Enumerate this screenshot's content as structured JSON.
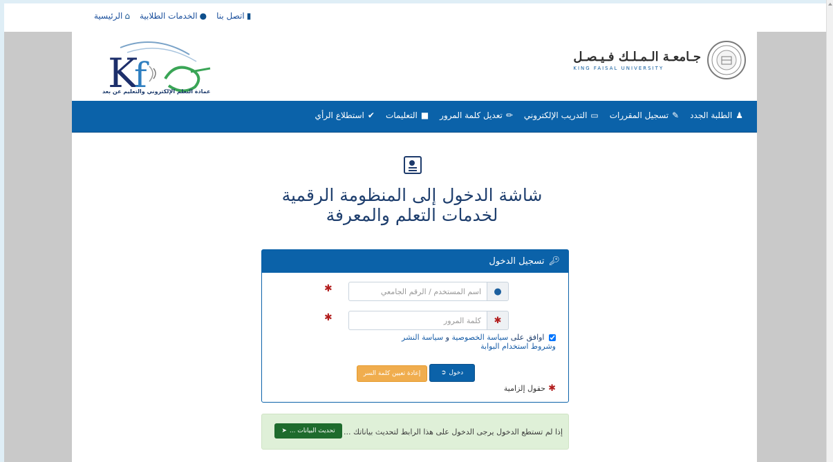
{
  "topbar": {
    "links": [
      {
        "label": "الرئيسية",
        "icon": "home-icon"
      },
      {
        "label": "الخدمات الطلابية",
        "icon": "user-icon"
      },
      {
        "label": "اتصل بنا",
        "icon": "phone-icon"
      }
    ]
  },
  "header": {
    "university_ar": "جـامعـة الـمـلـك فـيـصـل",
    "university_en": "KING FAISAL UNIVERSITY",
    "deanship_caption": "عمادة التعلم الإلكتروني والتعليم عن بعد"
  },
  "nav": {
    "items": [
      {
        "label": "الطلبة الجدد",
        "icon": "users-icon"
      },
      {
        "label": "تسجيل المقررات",
        "icon": "edit-icon"
      },
      {
        "label": "التدريب الإلكتروني",
        "icon": "monitor-icon"
      },
      {
        "label": "تعديل كلمة المرور",
        "icon": "pencil-icon"
      },
      {
        "label": "التعليمات",
        "icon": "comment-icon"
      },
      {
        "label": "استطلاع الرأي",
        "icon": "check-icon"
      }
    ]
  },
  "main": {
    "title": "شاشة الدخول إلى المنظومة الرقمية لخدمات التعلم والمعرفة"
  },
  "login": {
    "heading": "تسجيل الدخول",
    "username_placeholder": "اسم المستخدم / الرقم الجامعي",
    "password_placeholder": "كلمة المرور",
    "agree_prefix": "اوافق على",
    "privacy_link": "سياسة الخصوصية",
    "and": "و",
    "publish_link": "سياسة النشر وشروط استخدام البوابة",
    "agree_checked": true,
    "login_button": "دخول",
    "reset_button": "إعادة تعيين كلمة السر",
    "required_note": "حقول إلزامية"
  },
  "alert": {
    "text": "إذا لم تستطع الدخول يرجى الدخول على هذا الرابط لتحديث بياناتك ...",
    "button": "تحديث البيانات ..."
  },
  "colors": {
    "primary": "#0b62a9",
    "warning": "#f0ad4e",
    "success_bg": "#dff0d8",
    "success_button": "#1e6b2d",
    "required": "#b21d1d"
  }
}
